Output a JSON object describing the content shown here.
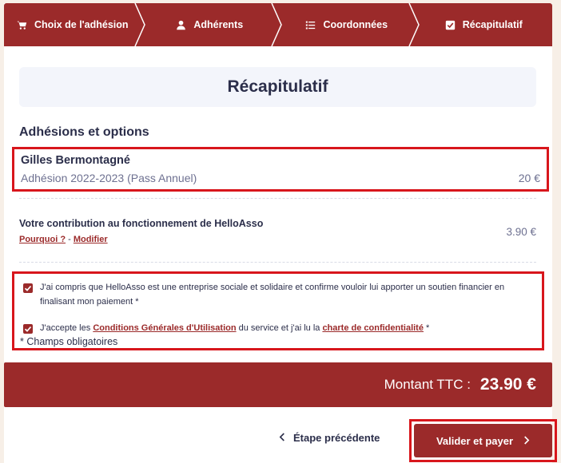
{
  "steps": [
    {
      "label": "Choix de l'adhésion",
      "icon": "cart-icon"
    },
    {
      "label": "Adhérents",
      "icon": "user-icon"
    },
    {
      "label": "Coordonnées",
      "icon": "list-icon"
    },
    {
      "label": "Récapitulatif",
      "icon": "checkbox-icon"
    }
  ],
  "page_title": "Récapitulatif",
  "section_title": "Adhésions et options",
  "member": {
    "name": "Gilles Bermontagné",
    "plan": "Adhésion 2022-2023 (Pass Annuel)",
    "price": "20 €"
  },
  "contribution": {
    "title": "Votre contribution au fonctionnement de HelloAsso",
    "why_link": "Pourquoi ?",
    "separator": " - ",
    "modify_link": "Modifier",
    "price": "3.90 €"
  },
  "legal": {
    "consent_text": "J'ai compris que HelloAsso est une entreprise sociale et solidaire et confirme vouloir lui apporter un soutien financier en finalisant mon paiement *",
    "terms_prefix": "J'accepte les ",
    "terms_link": "Conditions Générales d'Utilisation",
    "terms_middle": " du service et j'ai lu la ",
    "privacy_link": "charte de confidentialité",
    "terms_suffix": " *",
    "required_note": "* Champs obligatoires"
  },
  "total": {
    "label": "Montant TTC :",
    "value": "23.90 €"
  },
  "actions": {
    "previous_label": "Étape précédente",
    "pay_label": "Valider et payer"
  },
  "colors": {
    "brand": "#9b2a2a",
    "highlight": "#d8161c",
    "text": "#2b2e4a",
    "muted": "#6e7191"
  }
}
